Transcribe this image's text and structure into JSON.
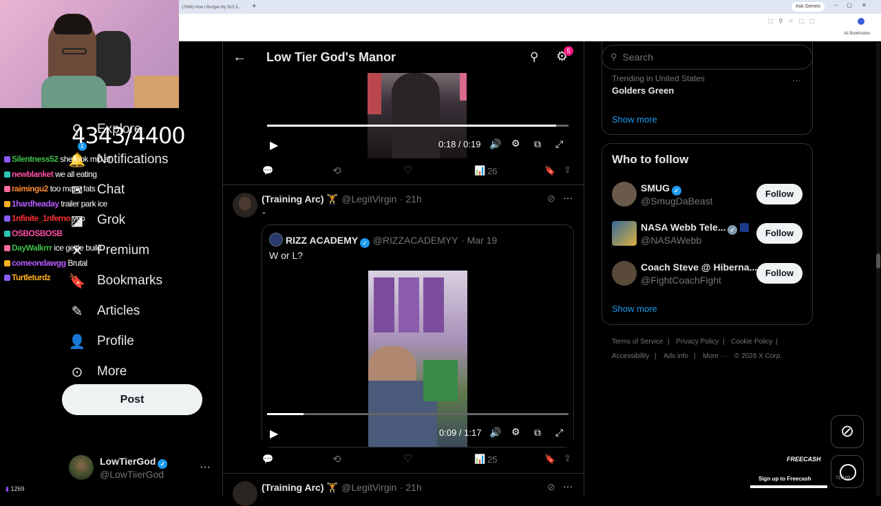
{
  "browser": {
    "tab_title": "(7684) How I Budget My $15,3...",
    "new_tab": "+",
    "ask_gemini": "Ask Gemini",
    "all_bookmarks": "All Bookmarks"
  },
  "stream": {
    "counter": "4343/4400",
    "chat": [
      {
        "user": "Silentness52",
        "color": "#3fbf4a",
        "message": "she look mid af"
      },
      {
        "user": "newblanket",
        "color": "#ff4fa6",
        "message": "we all eating"
      },
      {
        "user": "raimingu2",
        "color": "#ff8a30",
        "message": "too many fats"
      },
      {
        "user": "1hardheaday",
        "color": "#b45cff",
        "message": "trailer park ice"
      },
      {
        "user": "1nfinite_1nferno",
        "color": "#ff3030",
        "message": "yep"
      },
      {
        "user": "OSBOSBOSB",
        "color": "#ff4fa6",
        "message": ""
      },
      {
        "user": "DayWalkrrr",
        "color": "#3fbf4a",
        "message": "ice gettle build"
      },
      {
        "user": "comeondawgg",
        "color": "#b45cff",
        "message": "Brutal"
      },
      {
        "user": "Turtleturdz",
        "color": "#ffb020",
        "message": ""
      }
    ],
    "viewer_count": "1269"
  },
  "nav": {
    "items": [
      {
        "label": "Explore",
        "icon": "search-icon",
        "glyph": "⚲"
      },
      {
        "label": "Notifications",
        "icon": "bell-icon",
        "glyph": "🔔"
      },
      {
        "label": "Chat",
        "icon": "mail-icon",
        "glyph": "✉"
      },
      {
        "label": "Grok",
        "icon": "grok-icon",
        "glyph": "◪"
      },
      {
        "label": "Premium",
        "icon": "x-premium-icon",
        "glyph": "✕"
      },
      {
        "label": "Bookmarks",
        "icon": "bookmark-icon",
        "glyph": "🔖"
      },
      {
        "label": "Articles",
        "icon": "article-icon",
        "glyph": "✎"
      },
      {
        "label": "Profile",
        "icon": "person-icon",
        "glyph": "👤"
      },
      {
        "label": "More",
        "icon": "more-circle-icon",
        "glyph": "⊙"
      }
    ],
    "notifications_badge": "1",
    "post_label": "Post",
    "account": {
      "name": "LowTierGod",
      "handle": "@LowTiierGod"
    }
  },
  "header": {
    "title": "Low Tier God's Manor",
    "settings_badge": "5"
  },
  "feed": {
    "video1": {
      "time": "0:18 / 0:19",
      "progress": 0.96
    },
    "tweet1_stats": {
      "views": "26"
    },
    "tweet2": {
      "name": "(Training Arc) 🏋",
      "handle": "@LegitVirgin",
      "time": "· 21h",
      "text": "-",
      "quote": {
        "name": "RIZZ ACADEMY",
        "handle": "@RIZZACADEMYY",
        "time": "· Mar 19",
        "text": "W or L?"
      },
      "video_time": "0:09 / 1:17",
      "progress": 0.12,
      "views": "25"
    },
    "tweet3": {
      "name": "(Training Arc) 🏋",
      "handle": "@LegitVirgin",
      "time": "· 21h"
    }
  },
  "sidebar": {
    "search_placeholder": "Search",
    "trending": {
      "context": "Trending in United States",
      "topic": "Golders Green"
    },
    "show_more": "Show more",
    "who_to_follow_title": "Who to follow",
    "follow_label": "Follow",
    "accounts": [
      {
        "name": "SMUG",
        "handle": "@SmugDaBeast"
      },
      {
        "name": "NASA Webb Tele...",
        "handle": "@NASAWebb"
      },
      {
        "name": "Coach Steve @ Hiberna...",
        "handle": "@FightCoachFight"
      }
    ],
    "show_more_2": "Show more",
    "footer": {
      "terms": "Terms of Service",
      "privacy": "Privacy Policy",
      "cookie": "Cookie Policy",
      "accessibility": "Accessibility",
      "ads": "Ads info",
      "more": "More ···",
      "copyright": "© 2026 X Corp."
    }
  },
  "freecash": {
    "brand": "FREECASH",
    "cta": "Sign up to Freecash",
    "count": "72/100"
  },
  "colors": {
    "accent": "#1d9bf0",
    "background": "#000000",
    "notification_pink": "#f91880"
  }
}
